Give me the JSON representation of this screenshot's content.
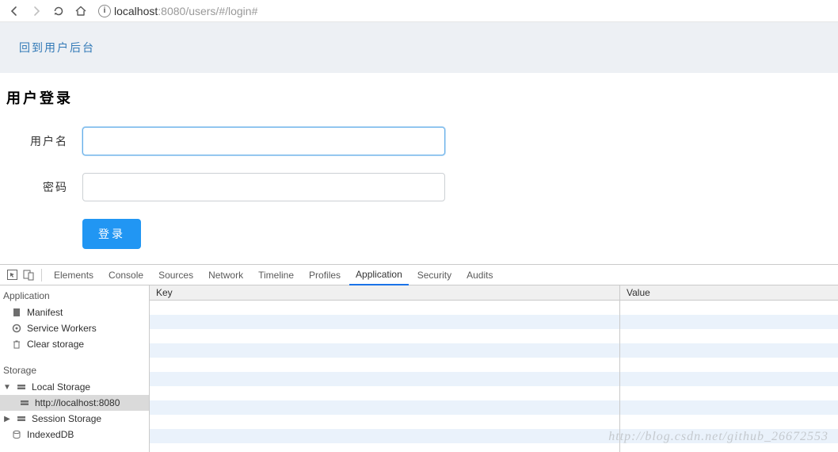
{
  "browser": {
    "url_host": "localhost",
    "url_port": ":8080",
    "url_path": "/users/#/login#"
  },
  "page": {
    "banner_link": "回到用户后台",
    "title": "用户登录",
    "username_label": "用户名",
    "username_value": "",
    "password_label": "密码",
    "password_value": "",
    "login_button": "登录"
  },
  "devtools": {
    "tabs": {
      "elements": "Elements",
      "console": "Console",
      "sources": "Sources",
      "network": "Network",
      "timeline": "Timeline",
      "profiles": "Profiles",
      "application": "Application",
      "security": "Security",
      "audits": "Audits"
    },
    "side": {
      "application_group": "Application",
      "manifest": "Manifest",
      "service_workers": "Service Workers",
      "clear_storage": "Clear storage",
      "storage_group": "Storage",
      "local_storage": "Local Storage",
      "local_storage_item": "http://localhost:8080",
      "session_storage": "Session Storage",
      "indexeddb": "IndexedDB"
    },
    "kv": {
      "key_header": "Key",
      "value_header": "Value"
    }
  },
  "watermark": "http://blog.csdn.net/github_26672553"
}
